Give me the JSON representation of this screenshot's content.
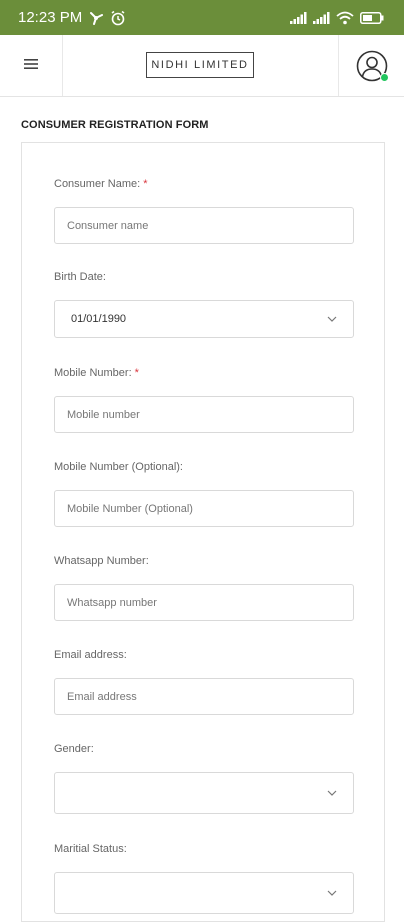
{
  "status_bar": {
    "time": "12:23 PM",
    "icons": [
      "fan-icon",
      "alarm-icon",
      "signal-icon",
      "signal-icon",
      "wifi-icon",
      "battery-icon"
    ]
  },
  "header": {
    "brand": "NIDHI LIMITED",
    "menu_icon": "hamburger-icon",
    "account_icon": "user-circle-icon",
    "accent": "#6b8e3a",
    "online_color": "#22c55e"
  },
  "form": {
    "title": "CONSUMER REGISTRATION FORM",
    "required_mark": "*",
    "fields": {
      "consumer_name": {
        "label": "Consumer Name:",
        "placeholder": "Consumer name"
      },
      "birth_date": {
        "label": "Birth Date:",
        "value": "01/01/1990"
      },
      "mobile": {
        "label": "Mobile Number:",
        "placeholder": "Mobile number"
      },
      "mobile_optional": {
        "label": "Mobile Number (Optional):",
        "placeholder": "Mobile Number (Optional)"
      },
      "whatsapp": {
        "label": "Whatsapp Number:",
        "placeholder": "Whatsapp number"
      },
      "email": {
        "label": "Email address:",
        "placeholder": "Email address"
      },
      "gender": {
        "label": "Gender:",
        "value": ""
      },
      "marital": {
        "label": "Maritial Status:",
        "value": ""
      }
    }
  }
}
